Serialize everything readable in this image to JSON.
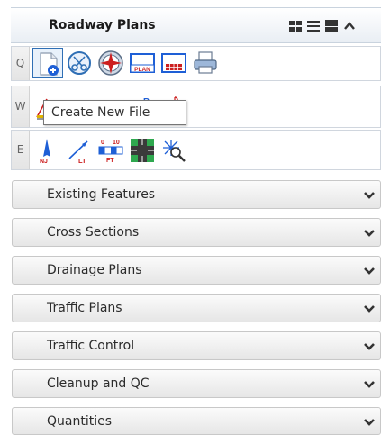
{
  "header": {
    "title": "Roadway Plans",
    "controls": [
      "grid-view-icon",
      "list-view-icon",
      "large-view-icon",
      "collapse-icon"
    ]
  },
  "rows": [
    {
      "key": "Q",
      "tools": [
        "create-new-file-icon",
        "cut-icon",
        "compass-rose-icon",
        "plan-sheet-icon",
        "table-sheet-icon",
        "print-icon"
      ]
    },
    {
      "key": "W",
      "tools": [
        "annotation-tool-icon",
        "annotation-tool-icon",
        "annotation-tool-icon",
        "text-label-icon",
        "text-style-icon"
      ]
    },
    {
      "key": "E",
      "tools": [
        "north-arrow-icon",
        "leader-label-icon",
        "scale-bar-icon",
        "intersection-icon",
        "search-snowflake-icon"
      ]
    }
  ],
  "tooltip": {
    "text": "Create New File"
  },
  "sections": [
    {
      "label": "Existing Features"
    },
    {
      "label": "Cross Sections"
    },
    {
      "label": "Drainage Plans"
    },
    {
      "label": "Traffic Plans"
    },
    {
      "label": "Traffic Control"
    },
    {
      "label": "Cleanup and QC"
    },
    {
      "label": "Quantities"
    }
  ],
  "icon_text": {
    "plan_sheet": "PLAN",
    "ne_marker": "B",
    "text_tool": "A",
    "north_arrow": "NJ",
    "leader": "LT",
    "scale_top_left": "0",
    "scale_top_right": "10",
    "scale_unit": "FT"
  },
  "colors": {
    "accent": "#2f6fb5",
    "header_bg": "#e9eef4",
    "section_bg": "#e6e6e6",
    "tooltip_border": "#767676",
    "icon_red": "#cc1f1f",
    "icon_blue": "#1e5fd6",
    "icon_green": "#2fa84f"
  }
}
